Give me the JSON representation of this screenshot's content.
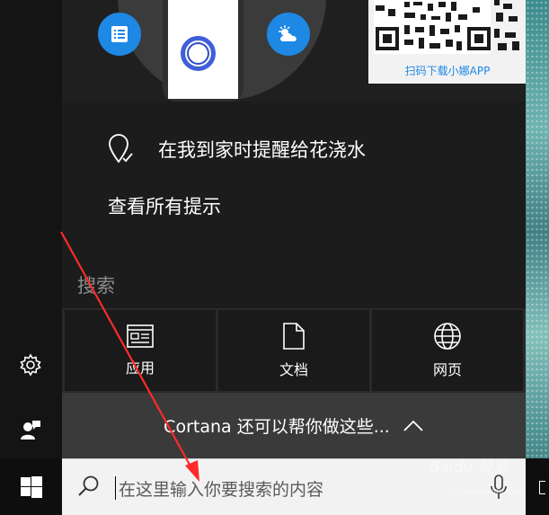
{
  "colors": {
    "accent": "#1e88e5",
    "cortana_ring": "#3f5fd8",
    "panel_bg": "#2a2a2a",
    "tile_bg": "#1a1a1a",
    "search_box_bg": "#f2f2f2",
    "annotation_arrow": "#ff2a2a"
  },
  "hero": {
    "qr_caption": "扫码下载小娜APP",
    "icons": [
      "list-icon",
      "weather-icon",
      "cortana-ring-icon",
      "qr-code-icon"
    ]
  },
  "tips": {
    "reminder_text": "在我到家时提醒给花浇水",
    "reminder_icon": "location-pin-check-icon",
    "view_all": "查看所有提示"
  },
  "search": {
    "heading": "搜索",
    "tiles": [
      {
        "label": "应用",
        "icon": "apps-window-icon"
      },
      {
        "label": "文档",
        "icon": "document-icon"
      },
      {
        "label": "网页",
        "icon": "globe-icon"
      }
    ]
  },
  "cortana_bar": {
    "label": "Cortana 还可以帮你做这些..."
  },
  "taskbar": {
    "search_placeholder": "在这里输入你要搜索的内容",
    "icons": [
      "windows-logo-icon",
      "search-icon",
      "microphone-icon"
    ]
  },
  "rail": {
    "icons": [
      "settings-gear-icon",
      "feedback-icon"
    ]
  },
  "watermark": {
    "brand": "Baidu 经验",
    "sub": "jingyan.baidu.com"
  }
}
